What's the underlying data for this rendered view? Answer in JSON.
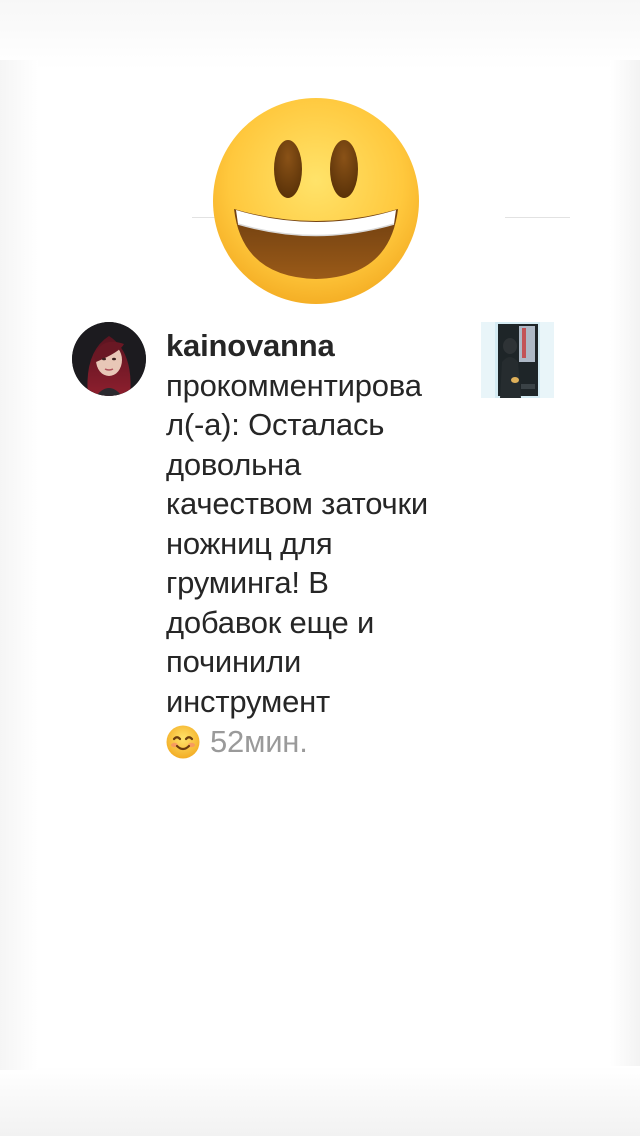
{
  "hero": {
    "icon": "grinning-face-emoji-icon"
  },
  "notification": {
    "username": "kainovanna",
    "comment_lines": [
      "прокомментирова",
      "л(-а): Осталась",
      "довольна",
      "качеством заточки",
      "ножниц для",
      "груминга! В",
      "добавок еще и",
      "починили",
      "инструмент"
    ],
    "reaction_icon": "smiling-face-emoji-icon",
    "time": "52мин.",
    "avatar_icon": "user-avatar-photo",
    "thumbnail_icon": "post-thumbnail-photo"
  },
  "colors": {
    "emoji_yellow": "#FFC83D",
    "text": "#262626",
    "secondary_text": "#9A9A9A"
  }
}
